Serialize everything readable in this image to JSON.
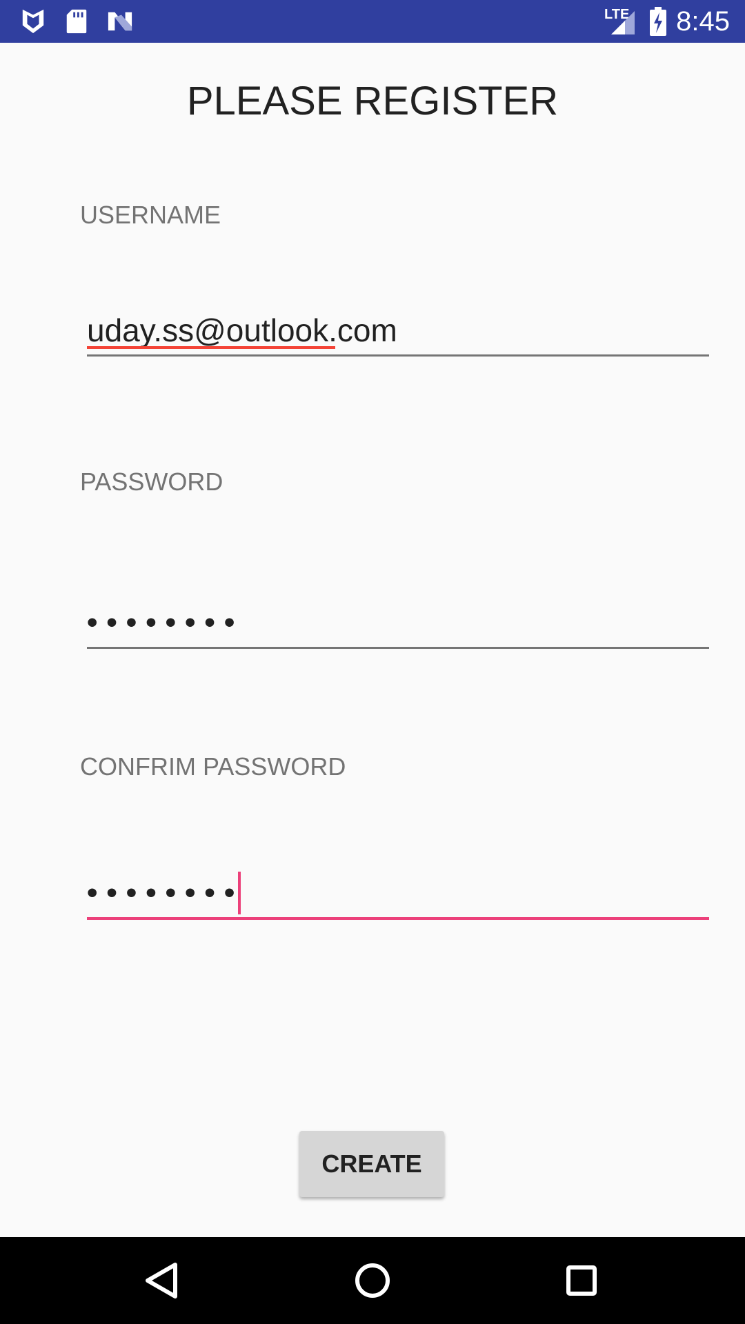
{
  "status_bar": {
    "time": "8:45",
    "network_label": "LTE",
    "icons": [
      "shield-icon",
      "sd-card-icon",
      "n-logo-icon",
      "lte-signal-icon",
      "battery-charging-icon"
    ]
  },
  "page": {
    "title": "PLEASE REGISTER"
  },
  "form": {
    "username": {
      "label": "USERNAME",
      "value": "uday.ss@outlook.com"
    },
    "password": {
      "label": "PASSWORD",
      "value_masked": "••••••••"
    },
    "confirm_password": {
      "label": "CONFRIM PASSWORD",
      "value_masked": "••••••••"
    },
    "create_label": "CREATE"
  },
  "colors": {
    "status_bar": "#303f9f",
    "accent": "#ec407a",
    "spellcheck": "#f44336",
    "background": "#fafafa"
  },
  "nav_bar": {
    "icons": [
      "back-icon",
      "home-icon",
      "recents-icon"
    ]
  }
}
